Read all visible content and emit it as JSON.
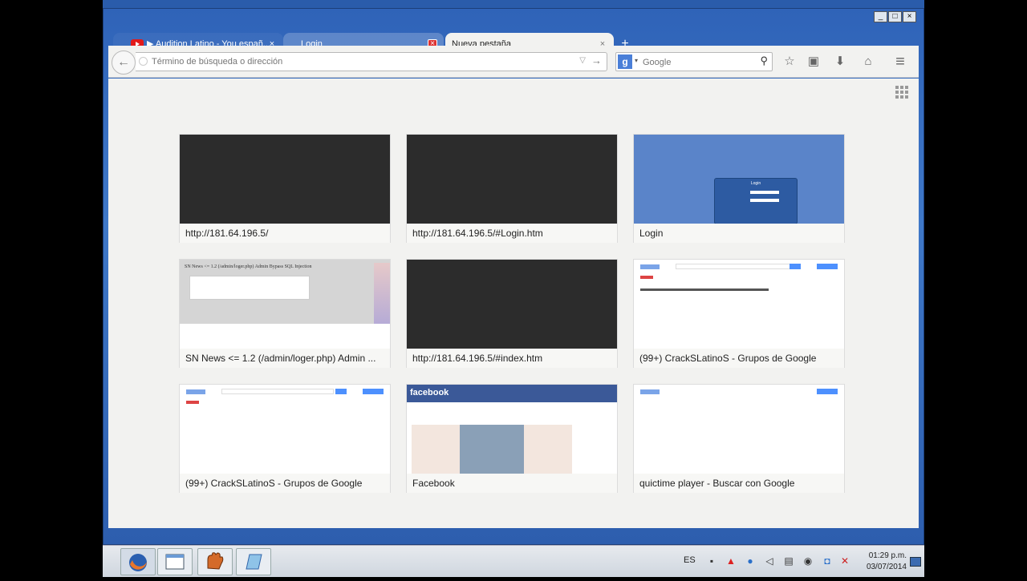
{
  "tabs": [
    {
      "label": "▶ Audition Latino - You españ...",
      "close": "×"
    },
    {
      "label": "Login",
      "close": "×"
    },
    {
      "label": "Nueva pestaña",
      "close": "×"
    }
  ],
  "new_tab": "+",
  "window_buttons": {
    "minimize": "_",
    "maximize": "□",
    "close": "×"
  },
  "navbar": {
    "back": "←",
    "url_placeholder": "Término de búsqueda o dirección",
    "url_dropdown": "▽",
    "go": "→",
    "search_engine": "g",
    "search_dropdown": "▾",
    "search_placeholder": "Google",
    "search_icon": "⚲",
    "bookmark": "☆",
    "reading_list": "▣",
    "downloads": "⬇",
    "home": "⌂",
    "menu": "≡"
  },
  "tiles": [
    {
      "label": "http://181.64.196.5/"
    },
    {
      "label": "http://181.64.196.5/#Login.htm"
    },
    {
      "label": "Login"
    },
    {
      "label": "SN News <= 1.2 (/admin/loger.php) Admin ..."
    },
    {
      "label": "http://181.64.196.5/#index.htm"
    },
    {
      "label": "(99+) CrackSLatinoS - Grupos de Google"
    },
    {
      "label": "(99+) CrackSLatinoS - Grupos de Google"
    },
    {
      "label": "Facebook"
    },
    {
      "label": "quictime player - Buscar con Google"
    }
  ],
  "thumb_text": {
    "login_title": "Login",
    "sn_header": "SN News <= 1.2 (/admin/loger.php) Admin Bypass SQL Injection",
    "fb_logo": "facebook"
  },
  "taskbar": {
    "language": "ES",
    "time": "01:29 p.m.",
    "date": "03/07/2014"
  }
}
